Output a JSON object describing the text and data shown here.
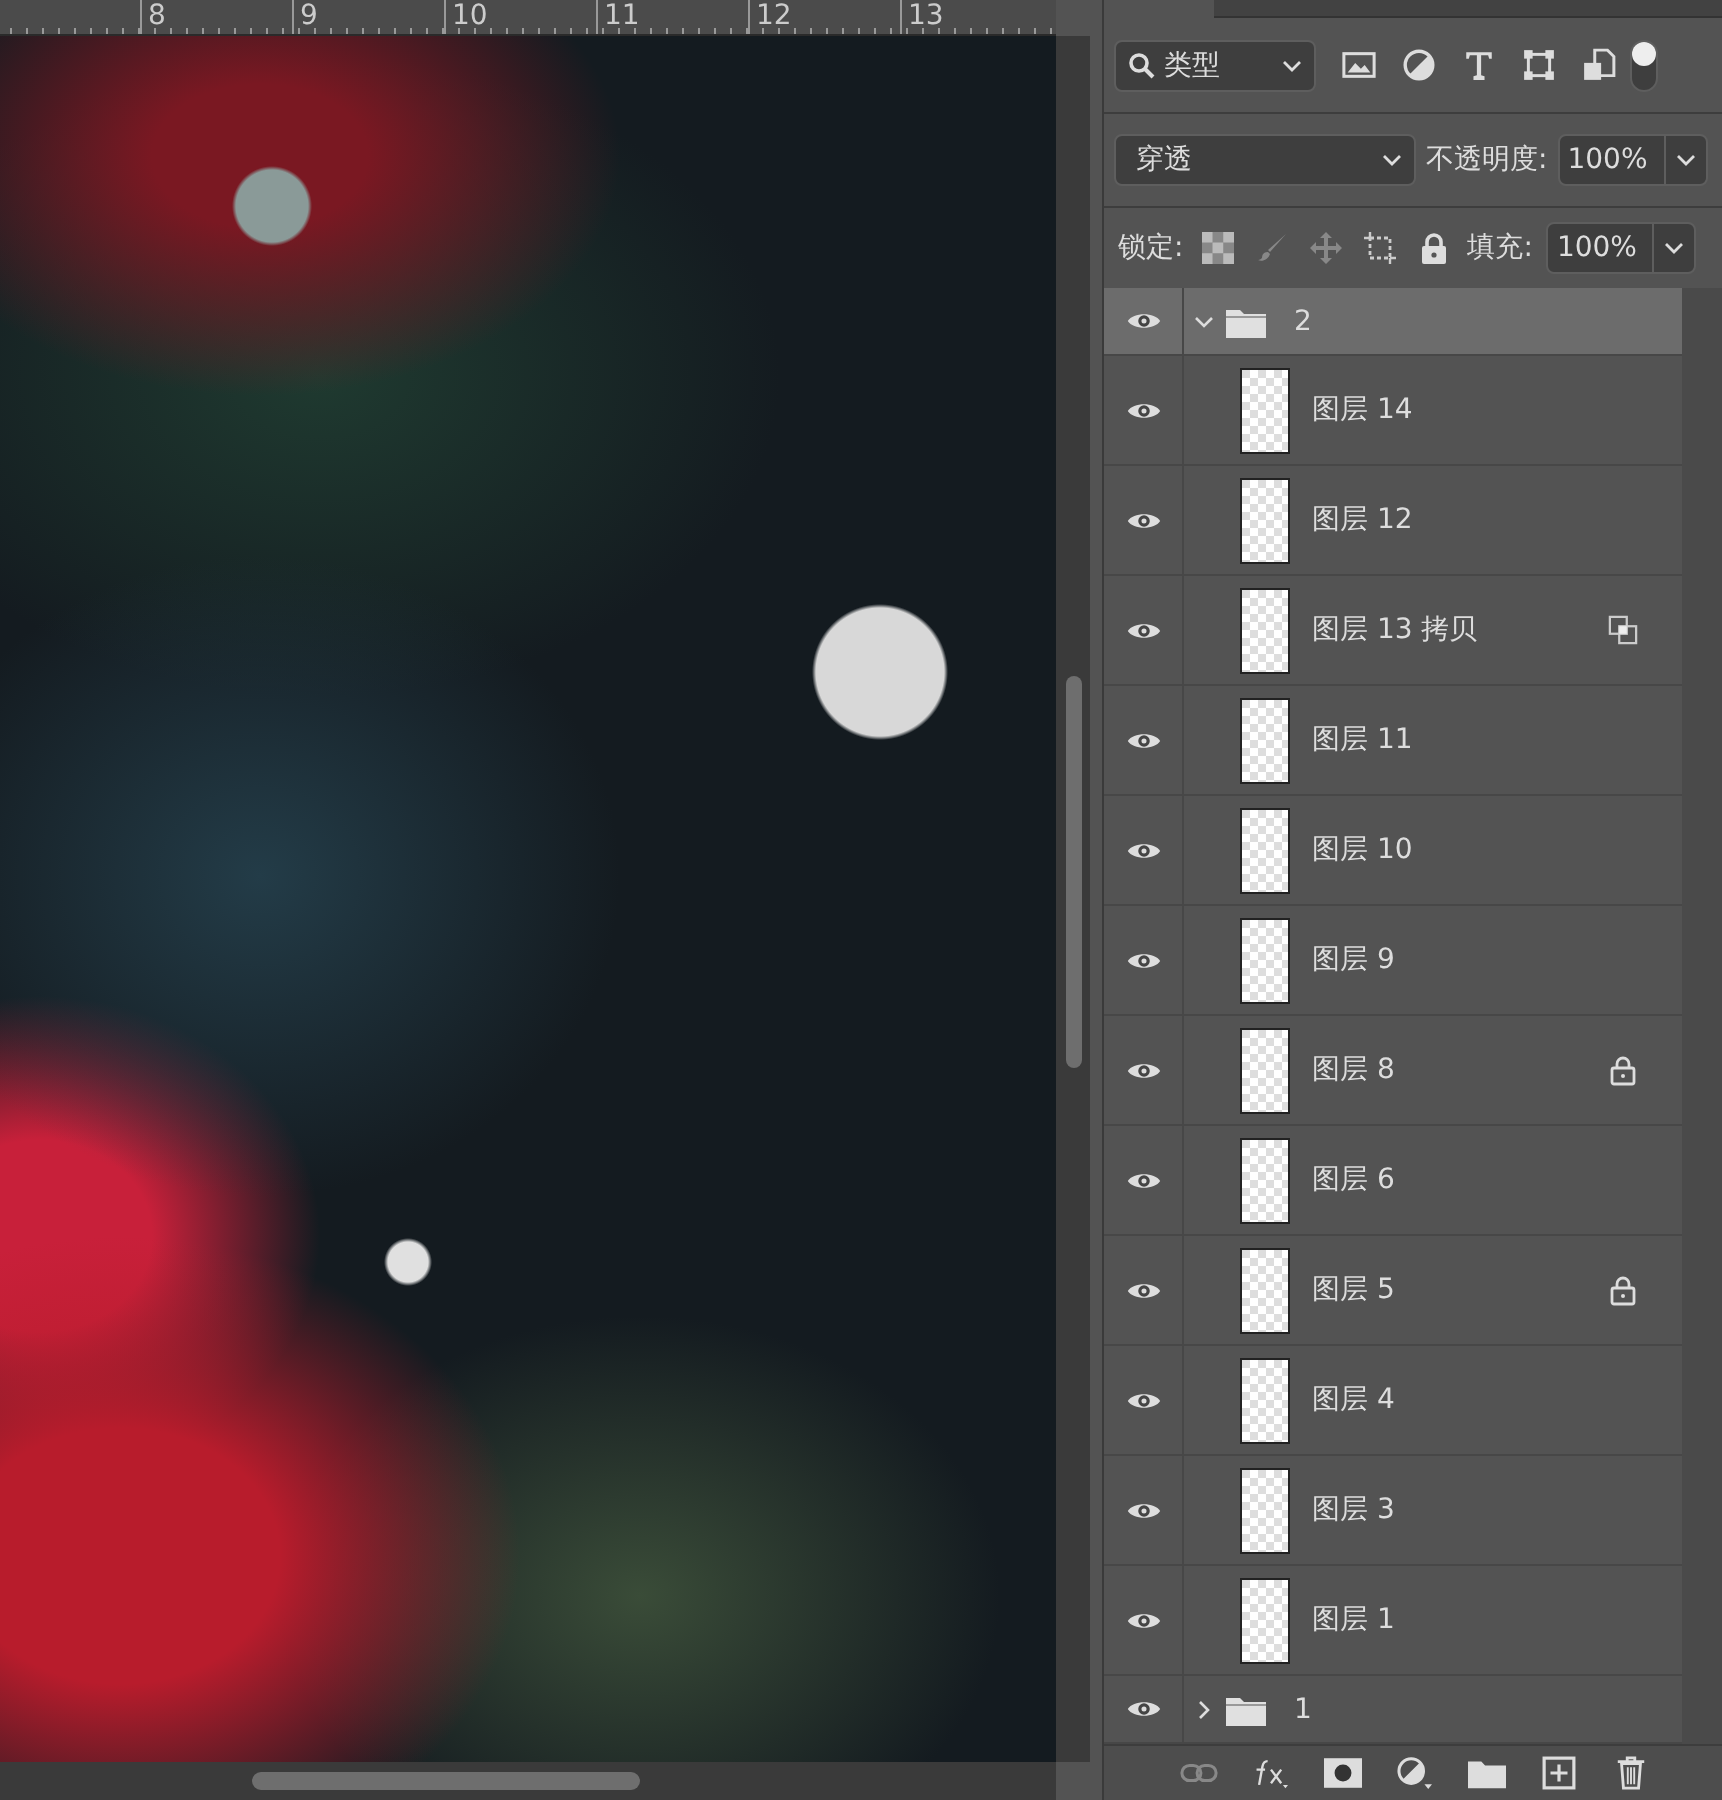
{
  "ruler": {
    "labels": [
      "8",
      "9",
      "10",
      "11",
      "12",
      "13"
    ]
  },
  "layers_panel": {
    "filter": {
      "value": "类型"
    },
    "blend_mode": {
      "value": "穿透"
    },
    "opacity": {
      "label": "不透明度:",
      "value": "100%"
    },
    "lock": {
      "label": "锁定:"
    },
    "fill": {
      "label": "填充:",
      "value": "100%"
    },
    "layers": [
      {
        "kind": "group",
        "name": "2",
        "visible": true,
        "selected": true,
        "expanded": true,
        "children": [
          {
            "kind": "layer",
            "name": "图层 14",
            "visible": true,
            "selected": false,
            "locked": false,
            "smart_object": false
          },
          {
            "kind": "layer",
            "name": "图层 12",
            "visible": true,
            "selected": false,
            "locked": false,
            "smart_object": false
          },
          {
            "kind": "layer",
            "name": "图层 13 拷贝",
            "visible": true,
            "selected": false,
            "locked": false,
            "smart_object": true
          },
          {
            "kind": "layer",
            "name": "图层 11",
            "visible": true,
            "selected": false,
            "locked": false,
            "smart_object": false
          },
          {
            "kind": "layer",
            "name": "图层 10",
            "visible": true,
            "selected": false,
            "locked": false,
            "smart_object": false
          },
          {
            "kind": "layer",
            "name": "图层 9",
            "visible": true,
            "selected": false,
            "locked": false,
            "smart_object": false
          },
          {
            "kind": "layer",
            "name": "图层 8",
            "visible": true,
            "selected": false,
            "locked": true,
            "smart_object": false
          },
          {
            "kind": "layer",
            "name": "图层 6",
            "visible": true,
            "selected": false,
            "locked": false,
            "smart_object": false
          },
          {
            "kind": "layer",
            "name": "图层 5",
            "visible": true,
            "selected": false,
            "locked": true,
            "smart_object": false
          },
          {
            "kind": "layer",
            "name": "图层 4",
            "visible": true,
            "selected": false,
            "locked": false,
            "smart_object": false
          },
          {
            "kind": "layer",
            "name": "图层 3",
            "visible": true,
            "selected": false,
            "locked": false,
            "smart_object": false
          },
          {
            "kind": "layer",
            "name": "图层 1",
            "visible": true,
            "selected": false,
            "locked": false,
            "smart_object": false
          }
        ]
      },
      {
        "kind": "group",
        "name": "1",
        "visible": true,
        "selected": false,
        "expanded": false
      }
    ]
  }
}
